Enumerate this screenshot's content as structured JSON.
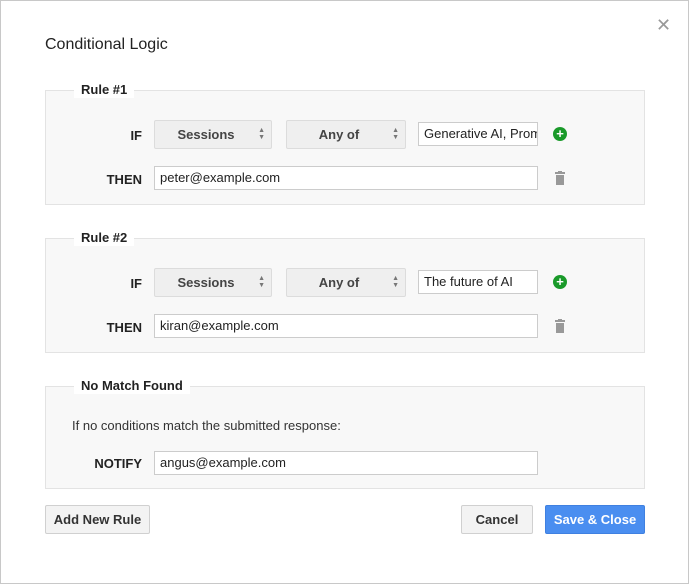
{
  "dialog": {
    "title": "Conditional Logic",
    "close_icon": "close-icon"
  },
  "rules": [
    {
      "legend": "Rule #1",
      "if_label": "IF",
      "field": "Sessions",
      "operator": "Any of",
      "value": "Generative AI, Prompt",
      "then_label": "THEN",
      "email": "peter@example.com"
    },
    {
      "legend": "Rule #2",
      "if_label": "IF",
      "field": "Sessions",
      "operator": "Any of",
      "value": "The future of AI",
      "then_label": "THEN",
      "email": "kiran@example.com"
    }
  ],
  "no_match": {
    "legend": "No Match Found",
    "info": "If no conditions match the submitted response:",
    "notify_label": "NOTIFY",
    "email": "angus@example.com"
  },
  "buttons": {
    "add": "Add New Rule",
    "cancel": "Cancel",
    "save": "Save & Close"
  },
  "colors": {
    "primary": "#4a8ef0",
    "add_icon": "#1a9a2a"
  }
}
